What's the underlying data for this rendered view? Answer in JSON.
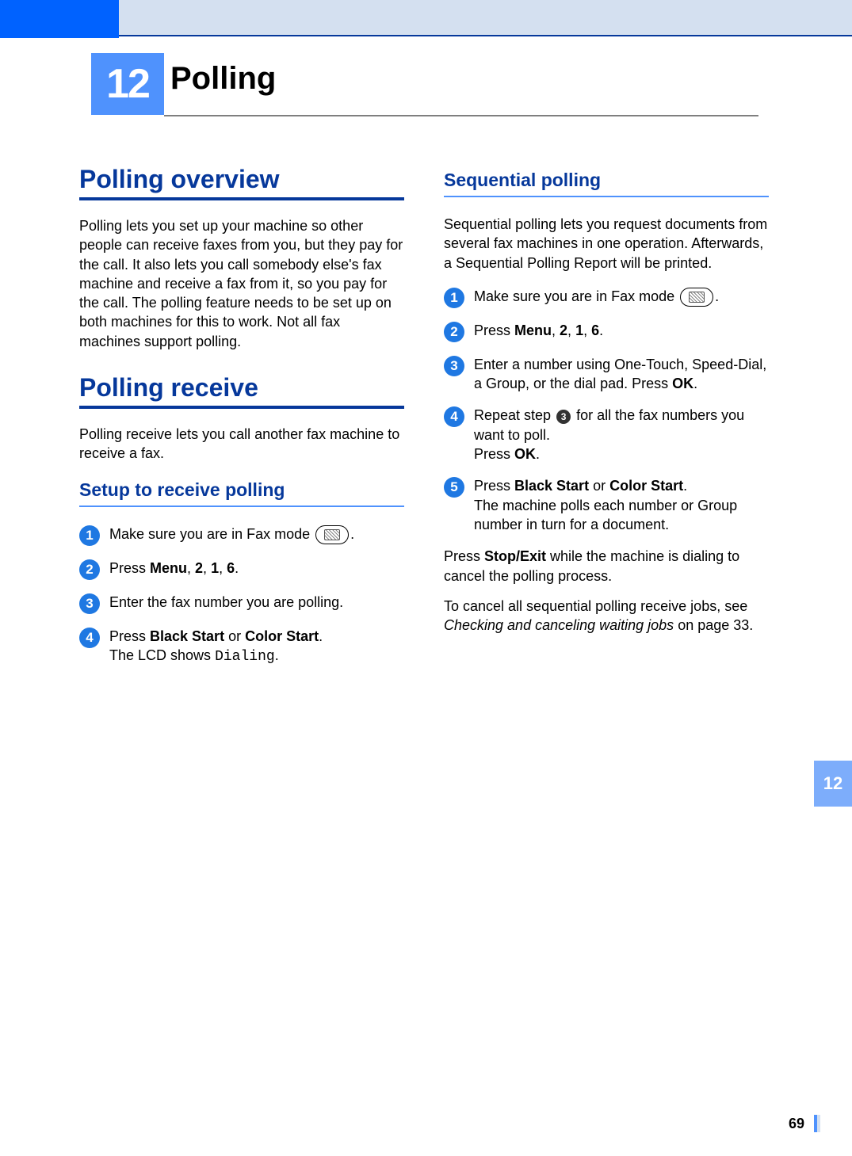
{
  "chapter": {
    "number": "12",
    "title": "Polling"
  },
  "side_tab": "12",
  "page_number": "69",
  "left": {
    "h1a": "Polling overview",
    "p1": "Polling lets you set up your machine so other people can receive faxes from you, but they pay for the call. It also lets you call somebody else's fax machine and receive a fax from it, so you pay for the call. The polling feature needs to be set up on both machines for this to work. Not all fax machines support polling.",
    "h1b": "Polling receive",
    "p2": "Polling receive lets you call another fax machine to receive a fax.",
    "h2": "Setup to receive polling",
    "steps": {
      "s1_pre": "Make sure you are in Fax mode ",
      "s1_post": ".",
      "s2a": "Press ",
      "s2b": "Menu",
      "s2c": ", ",
      "s2d": "2",
      "s2e": ", ",
      "s2f": "1",
      "s2g": ", ",
      "s2h": "6",
      "s2i": ".",
      "s3": "Enter the fax number you are polling.",
      "s4a": "Press ",
      "s4b": "Black Start",
      "s4c": " or ",
      "s4d": "Color Start",
      "s4e": ".",
      "s4f": "The LCD shows ",
      "s4g": "Dialing",
      "s4h": "."
    }
  },
  "right": {
    "h2": "Sequential polling",
    "p1": "Sequential polling lets you request documents from several fax machines in one operation. Afterwards, a Sequential Polling Report will be printed.",
    "steps": {
      "s1_pre": "Make sure you are in Fax mode ",
      "s1_post": ".",
      "s2a": "Press ",
      "s2b": "Menu",
      "s2c": ", ",
      "s2d": "2",
      "s2e": ", ",
      "s2f": "1",
      "s2g": ", ",
      "s2h": "6",
      "s2i": ".",
      "s3a": "Enter a number using One-Touch, Speed-Dial, a Group, or the dial pad. Press ",
      "s3b": "OK",
      "s3c": ".",
      "s4a": "Repeat step ",
      "s4ref": "3",
      "s4b": " for all the fax numbers you want to poll.",
      "s4c": "Press ",
      "s4d": "OK",
      "s4e": ".",
      "s5a": "Press ",
      "s5b": "Black Start",
      "s5c": " or ",
      "s5d": "Color Start",
      "s5e": ".",
      "s5f": "The machine polls each number or Group number in turn for a document."
    },
    "p2a": "Press ",
    "p2b": "Stop/Exit",
    "p2c": " while the machine is dialing to cancel the polling process.",
    "p3a": "To cancel all sequential polling receive jobs, see ",
    "p3b": "Checking and canceling waiting jobs",
    "p3c": " on page 33."
  }
}
